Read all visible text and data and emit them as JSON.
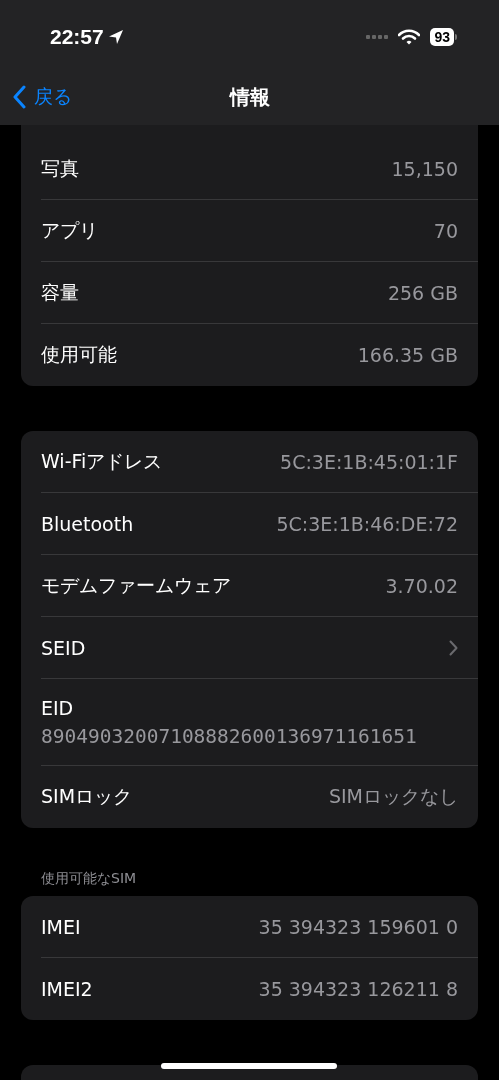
{
  "status_bar": {
    "time": "22:57",
    "battery": "93"
  },
  "nav": {
    "back": "戻る",
    "title": "情報"
  },
  "groups": [
    {
      "rows": [
        {
          "kind": "value",
          "label": "写真",
          "value": "15,150"
        },
        {
          "kind": "value",
          "label": "アプリ",
          "value": "70"
        },
        {
          "kind": "value",
          "label": "容量",
          "value": "256 GB"
        },
        {
          "kind": "value",
          "label": "使用可能",
          "value": "166.35 GB"
        }
      ]
    },
    {
      "rows": [
        {
          "kind": "value",
          "label": "Wi-Fiアドレス",
          "value": "5C:3E:1B:45:01:1F"
        },
        {
          "kind": "value",
          "label": "Bluetooth",
          "value": "5C:3E:1B:46:DE:72"
        },
        {
          "kind": "value",
          "label": "モデムファームウェア",
          "value": "3.70.02"
        },
        {
          "kind": "chevron",
          "label": "SEID"
        },
        {
          "kind": "stacked",
          "label": "EID",
          "value": "89049032007108882600136971161651"
        },
        {
          "kind": "value",
          "label": "SIMロック",
          "value": "SIMロックなし"
        }
      ]
    },
    {
      "header": "使用可能なSIM",
      "rows": [
        {
          "kind": "value",
          "label": "IMEI",
          "value": "35 394323 159601 0"
        },
        {
          "kind": "value",
          "label": "IMEI2",
          "value": "35 394323 126211 8"
        }
      ]
    }
  ]
}
